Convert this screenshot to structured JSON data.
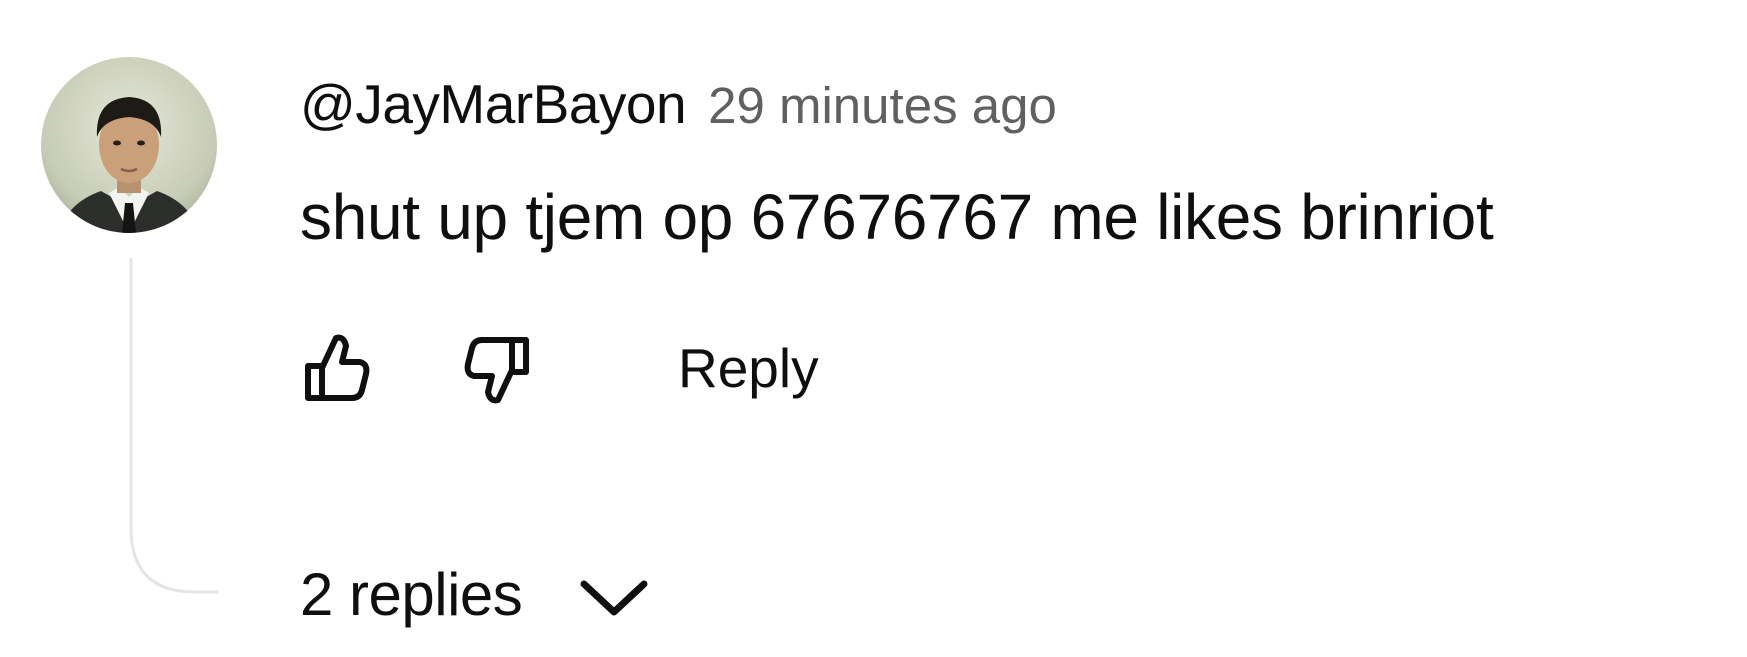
{
  "comment": {
    "author": "@JayMarBayon",
    "time": "29 minutes ago",
    "text": "shut up tjem op 67676767 me likes brinriot",
    "reply_label": "Reply",
    "replies_label": "2 replies",
    "icons": {
      "like": "thumbs-up-icon",
      "dislike": "thumbs-down-icon",
      "expand": "chevron-down-icon"
    }
  }
}
